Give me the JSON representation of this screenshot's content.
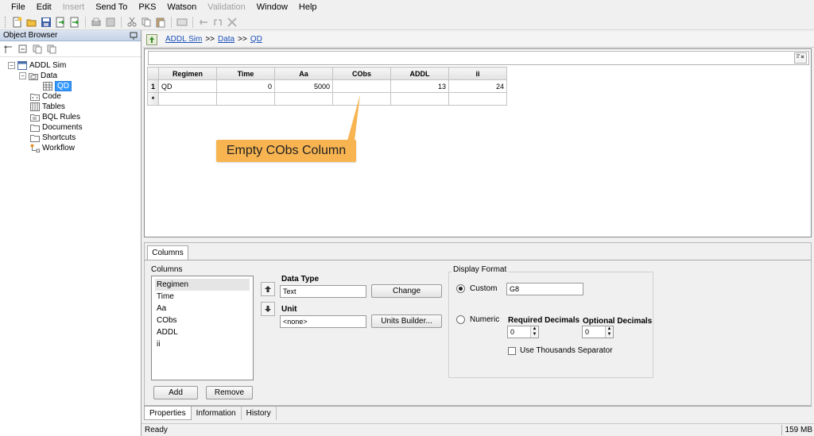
{
  "menu": [
    "File",
    "Edit",
    "Insert",
    "Send To",
    "PKS",
    "Watson",
    "Validation",
    "Window",
    "Help"
  ],
  "menu_disabled": [
    "Insert",
    "Validation"
  ],
  "object_browser": {
    "title": "Object Browser",
    "tree": {
      "root": "ADDL Sim",
      "data": "Data",
      "qd": "QD",
      "code": "Code",
      "tables": "Tables",
      "bql_rules": "BQL Rules",
      "documents": "Documents",
      "shortcuts": "Shortcuts",
      "workflow": "Workflow"
    }
  },
  "breadcrumb": {
    "root": "ADDL Sim",
    "sep": ">>",
    "data": "Data",
    "qd": "QD"
  },
  "grid": {
    "headers": [
      "Regimen",
      "Time",
      "Aa",
      "CObs",
      "ADDL",
      "ii"
    ],
    "row1": {
      "num": "1",
      "regimen": "QD",
      "time": "0",
      "aa": "5000",
      "cobs": "",
      "addl": "13",
      "ii": "24"
    },
    "new_row_marker": "*"
  },
  "callout": "Empty CObs Column",
  "props": {
    "tab": "Columns",
    "columns_label": "Columns",
    "columns": [
      "Regimen",
      "Time",
      "Aa",
      "CObs",
      "ADDL",
      "ii"
    ],
    "add": "Add",
    "remove": "Remove",
    "data_type_label": "Data Type",
    "data_type_value": "Text",
    "change": "Change",
    "unit_label": "Unit",
    "unit_value": "<none>",
    "units_builder": "Units Builder...",
    "display_format": "Display Format",
    "custom": "Custom",
    "custom_value": "G8",
    "numeric": "Numeric",
    "required_decimals": "Required Decimals",
    "required_value": "0",
    "optional_decimals": "Optional Decimals",
    "optional_value": "0",
    "thousands": "Use Thousands Separator"
  },
  "bottom_tabs": [
    "Properties",
    "Information",
    "History"
  ],
  "status": {
    "text": "Ready",
    "memory": "159 MB"
  },
  "colors": {
    "callout": "#f7b451",
    "selection": "#3399ff",
    "link": "#1a4fb8"
  }
}
